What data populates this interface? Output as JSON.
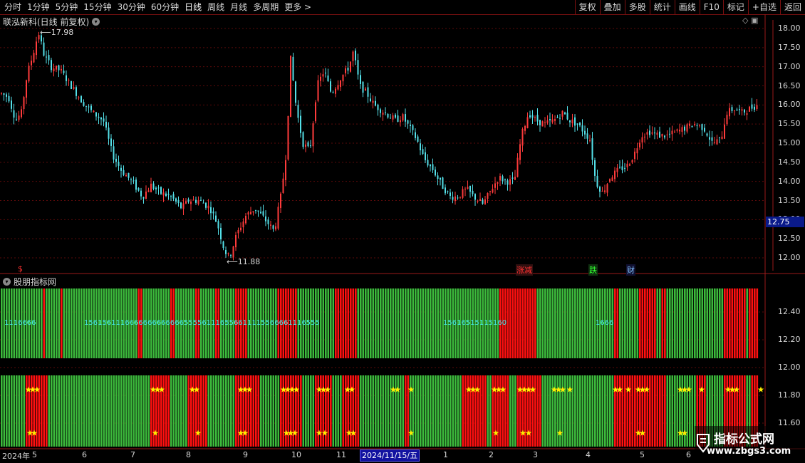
{
  "toolbar": {
    "left": [
      "分时",
      "1分钟",
      "5分钟",
      "15分钟",
      "30分钟",
      "60分钟",
      "日线",
      "周线",
      "月线",
      "多周期",
      "更多 >"
    ],
    "right": [
      "复权",
      "叠加",
      "多股",
      "统计",
      "画线",
      "F10",
      "标记",
      "+自选",
      "返回"
    ]
  },
  "main": {
    "title": "联泓新科(日线 前复权)",
    "high_label": "17.98",
    "low_label": "11.88",
    "current_price": "12.75",
    "price_axis": [
      "18.00",
      "17.50",
      "17.00",
      "16.50",
      "16.00",
      "15.50",
      "15.00",
      "14.50",
      "14.00",
      "13.50",
      "13.00",
      "12.50",
      "12.00"
    ],
    "signals": [
      {
        "text": "$",
        "color": "#ff3030"
      },
      {
        "text": "涨减",
        "color": "#ff3030"
      },
      {
        "text": "跌",
        "color": "#30ff30"
      },
      {
        "text": "财",
        "color": "#80c0ff"
      }
    ]
  },
  "indicator": {
    "title": "股朋指标网",
    "axis": [
      "12.40",
      "12.20",
      "12.00",
      "11.80",
      "11.60"
    ],
    "labels": [
      "1116666",
      "1561561116666666666666555561116556611115566661116555",
      "15616515115160",
      "1666"
    ]
  },
  "dates": {
    "labels": [
      "2024年",
      "5",
      "6",
      "7",
      "8",
      "9",
      "10",
      "11",
      "2024/11/15/五",
      "1",
      "2",
      "3",
      "4",
      "5",
      "6"
    ]
  },
  "watermark": {
    "title": "指标公式网",
    "url": "www.zbgs3.com"
  },
  "colors": {
    "up": "#ff3b3b",
    "down": "#54e0e8",
    "green": "#3cba3c",
    "red": "#ff1010",
    "star": "#ffee00"
  }
}
